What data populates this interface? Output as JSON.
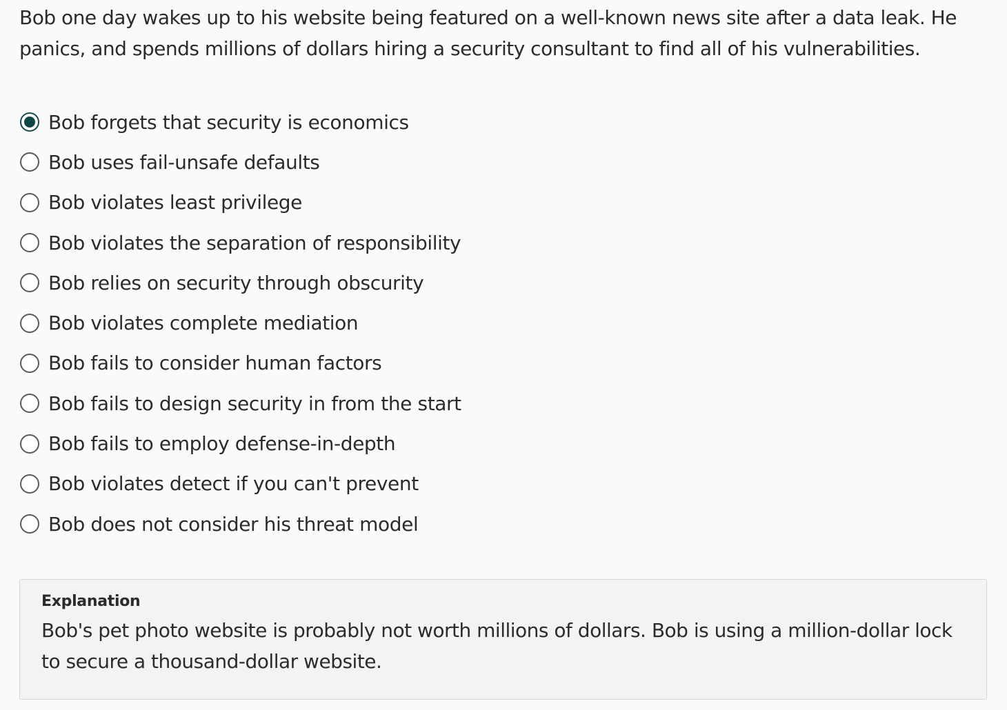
{
  "question": {
    "text": "Bob one day wakes up to his website being featured on a well-known news site after a data leak. He panics, and spends millions of dollars hiring a security consultant to find all of his vulnerabilities."
  },
  "options": [
    {
      "label": "Bob forgets that security is economics",
      "selected": true
    },
    {
      "label": "Bob uses fail-unsafe defaults",
      "selected": false
    },
    {
      "label": "Bob violates least privilege",
      "selected": false
    },
    {
      "label": "Bob violates the separation of responsibility",
      "selected": false
    },
    {
      "label": "Bob relies on security through obscurity",
      "selected": false
    },
    {
      "label": "Bob violates complete mediation",
      "selected": false
    },
    {
      "label": "Bob fails to consider human factors",
      "selected": false
    },
    {
      "label": "Bob fails to design security in from the start",
      "selected": false
    },
    {
      "label": "Bob fails to employ defense-in-depth",
      "selected": false
    },
    {
      "label": "Bob violates detect if you can't prevent",
      "selected": false
    },
    {
      "label": "Bob does not consider his threat model",
      "selected": false
    }
  ],
  "explanation": {
    "title": "Explanation",
    "text": "Bob's pet photo website is probably not worth millions of dollars. Bob is using a million-dollar lock to secure a thousand-dollar website."
  },
  "colors": {
    "selected_radio": "#0f4747",
    "background": "#fafafa",
    "explanation_background": "#f3f3f3"
  }
}
